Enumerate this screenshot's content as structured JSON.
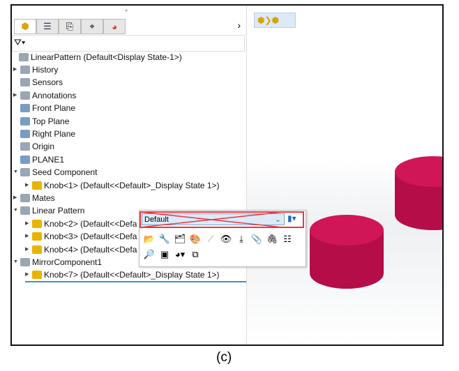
{
  "tabs": [
    "feature-manager",
    "property-manager",
    "configuration-manager",
    "dimxpert-manager",
    "display-manager"
  ],
  "tree": {
    "root": "LinearPattern  (Default<Display State-1>)",
    "items": [
      {
        "label": "History",
        "expand": true,
        "indent": 0
      },
      {
        "label": "Sensors",
        "expand": false,
        "indent": 0
      },
      {
        "label": "Annotations",
        "expand": true,
        "indent": 0
      },
      {
        "label": "Front Plane",
        "expand": false,
        "indent": 0
      },
      {
        "label": "Top Plane",
        "expand": false,
        "indent": 0
      },
      {
        "label": "Right Plane",
        "expand": false,
        "indent": 0
      },
      {
        "label": "Origin",
        "expand": false,
        "indent": 0
      },
      {
        "label": "PLANE1",
        "expand": false,
        "indent": 0
      },
      {
        "label": "Seed Component",
        "expand": "open",
        "indent": 0
      },
      {
        "label": "Knob<1> (Default<<Default>_Display State 1>)",
        "expand": true,
        "indent": 1
      },
      {
        "label": "Mates",
        "expand": true,
        "indent": 0
      },
      {
        "label": "Linear Pattern",
        "expand": "open",
        "indent": 0
      },
      {
        "label": "Knob<2> (Default<<Defa",
        "expand": true,
        "indent": 1
      },
      {
        "label": "Knob<3> (Default<<Defa",
        "expand": true,
        "indent": 1
      },
      {
        "label": "Knob<4> (Default<<Defa",
        "expand": true,
        "indent": 1
      },
      {
        "label": "MirrorComponent1",
        "expand": "open",
        "indent": 0
      },
      {
        "label": "Knob<7> (Default<<Default>_Display State 1>)",
        "expand": true,
        "indent": 1,
        "selected": true
      }
    ]
  },
  "popup": {
    "config_value": "Default"
  },
  "caption": "(c)",
  "colors": {
    "part": "#c8104f",
    "highlight": "#e8373f"
  }
}
